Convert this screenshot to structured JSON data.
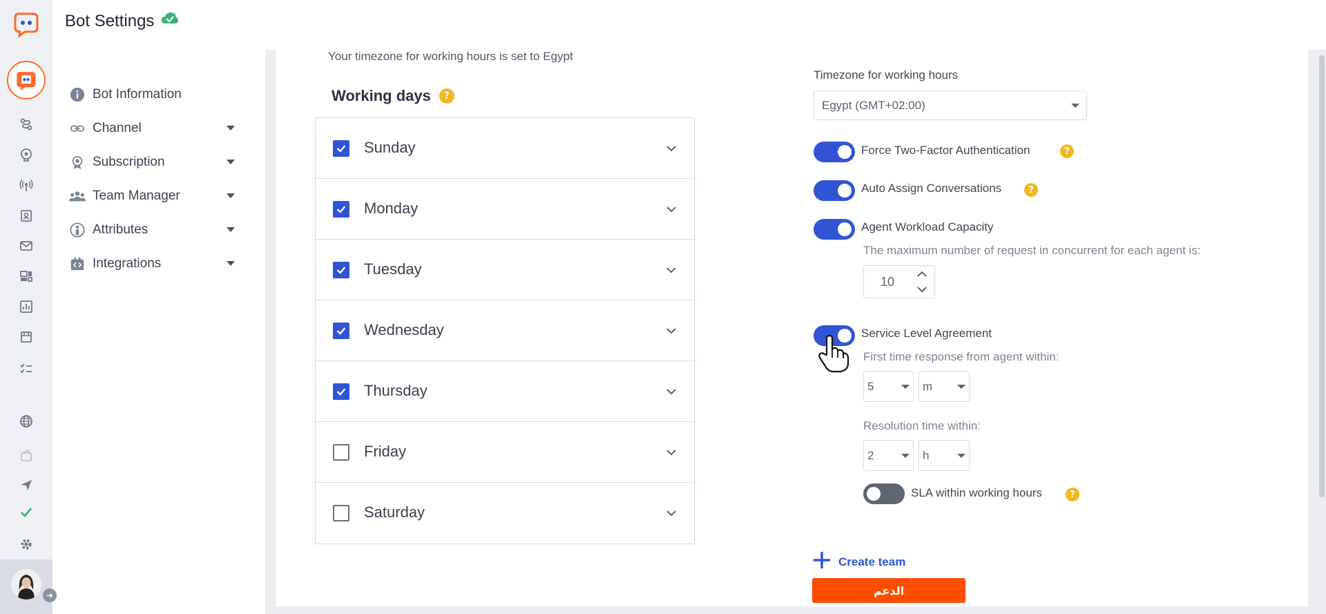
{
  "header": {
    "title": "Bot Settings",
    "status_icon": "cloud-check-icon"
  },
  "colors": {
    "accent": "#2f55d4",
    "brand": "#ff6a2b",
    "help": "#f3b81e",
    "support": "#ff4d00",
    "status_ok": "#3bb273"
  },
  "rail": {
    "icons": [
      "workflow-icon",
      "brain-icon",
      "broadcast-icon",
      "contacts-icon",
      "mail-icon",
      "templates-icon",
      "analytics-icon",
      "store-icon",
      "tasks-icon",
      "globe-icon",
      "wallet-icon",
      "send-icon",
      "check-icon",
      "gear-icon"
    ]
  },
  "sidebar": {
    "items": [
      {
        "label": "Bot Information",
        "icon": "info-icon",
        "expandable": false
      },
      {
        "label": "Channel",
        "icon": "link-icon",
        "expandable": true
      },
      {
        "label": "Subscription",
        "icon": "badge-icon",
        "expandable": true
      },
      {
        "label": "Team Manager",
        "icon": "team-icon",
        "expandable": true
      },
      {
        "label": "Attributes",
        "icon": "person-icon",
        "expandable": true
      },
      {
        "label": "Integrations",
        "icon": "code-icon",
        "expandable": true
      }
    ]
  },
  "working_days": {
    "timezone_note": "Your timezone for working hours is set to Egypt",
    "title": "Working days",
    "days": [
      {
        "name": "Sunday",
        "checked": true
      },
      {
        "name": "Monday",
        "checked": true
      },
      {
        "name": "Tuesday",
        "checked": true
      },
      {
        "name": "Wednesday",
        "checked": true
      },
      {
        "name": "Thursday",
        "checked": true
      },
      {
        "name": "Friday",
        "checked": false
      },
      {
        "name": "Saturday",
        "checked": false
      }
    ]
  },
  "settings": {
    "timezone_label": "Timezone for working hours",
    "timezone_value": "Egypt (GMT+02:00)",
    "force_2fa": {
      "label": "Force Two-Factor Authentication",
      "on": true
    },
    "auto_assign": {
      "label": "Auto Assign Conversations",
      "on": true
    },
    "workload": {
      "label": "Agent Workload Capacity",
      "on": true,
      "description": "The maximum number of request in concurrent for each agent is:",
      "value": "10"
    },
    "sla": {
      "label": "Service Level Agreement",
      "on": true,
      "first_response_label": "First time response from agent within:",
      "first_response_value": "5",
      "first_response_unit": "m",
      "resolution_label": "Resolution time within:",
      "resolution_value": "2",
      "resolution_unit": "h",
      "working_hours_label": "SLA within working hours",
      "working_hours_on": false
    },
    "create_team_label": "Create team",
    "support_label": "الدعم"
  }
}
